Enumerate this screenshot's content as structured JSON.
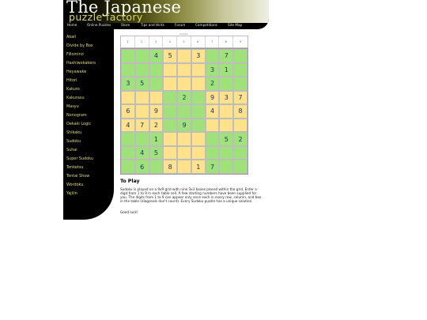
{
  "site": {
    "title": "The Japanese",
    "subtitle": "puzzle factory"
  },
  "nav": [
    {
      "label": "Home"
    },
    {
      "label": "Online Puzzles"
    },
    {
      "label": "Store"
    },
    {
      "label": "Tips and Hints"
    },
    {
      "label": "Forum"
    },
    {
      "label": "Competitions"
    },
    {
      "label": "Site Map"
    }
  ],
  "sidebar": {
    "items": [
      {
        "label": "Akari"
      },
      {
        "label": "Divide by Box"
      },
      {
        "label": "Fillomino"
      },
      {
        "label": "Hashiwokakero"
      },
      {
        "label": "Heyawake"
      },
      {
        "label": "Hitori"
      },
      {
        "label": "Kakuro"
      },
      {
        "label": "Kakurasu"
      },
      {
        "label": "Masyu"
      },
      {
        "label": "Nonogram"
      },
      {
        "label": "Oekaki Logic"
      },
      {
        "label": "Shikaku"
      },
      {
        "label": "Sudoku"
      },
      {
        "label": "Suhai"
      },
      {
        "label": "Super Sudoku"
      },
      {
        "label": "Tenketsu"
      },
      {
        "label": "Tentai Show"
      },
      {
        "label": "Wordoku"
      },
      {
        "label": "Yajilin"
      }
    ]
  },
  "puzzle": {
    "caption": "Sudoku",
    "columns": [
      "1",
      "2",
      "3",
      "4",
      "5",
      "6",
      "7",
      "8",
      "9"
    ],
    "colors": {
      "green": "#9fe27a",
      "yellow": "#ffe28a",
      "digit": "#1e2a7a"
    },
    "rows": [
      [
        "",
        "",
        "4",
        "5",
        "",
        "3",
        "",
        "7",
        ""
      ],
      [
        "",
        "",
        "",
        "",
        "",
        "",
        "3",
        "1",
        ""
      ],
      [
        "3",
        "5",
        "",
        "",
        "",
        "",
        "2",
        "",
        ""
      ],
      [
        "",
        "",
        "",
        "",
        "2",
        "",
        "9",
        "3",
        "7"
      ],
      [
        "6",
        "",
        "9",
        "",
        "",
        "",
        "4",
        "",
        "8"
      ],
      [
        "4",
        "7",
        "2",
        "",
        "9",
        "",
        "",
        "",
        ""
      ],
      [
        "",
        "",
        "1",
        "",
        "",
        "",
        "",
        "5",
        "2"
      ],
      [
        "",
        "4",
        "5",
        "",
        "",
        "",
        "",
        "",
        ""
      ],
      [
        "",
        "6",
        "",
        "8",
        "",
        "1",
        "7",
        "",
        ""
      ]
    ]
  },
  "content": {
    "heading": "To Play",
    "instructions": "Sudoku is played on a 9x9 grid with nine 3x3 boxes placed within the grid. Enter a digit from 1 to 9 in each table cell. A few starting numbers have been supplied for you. The digits from 1 to 9 can appear only once each in every row, column, and box in the table (diagonals don't count). Every Sudoku puzzle has a unique solution.",
    "closing": "Good luck!"
  }
}
